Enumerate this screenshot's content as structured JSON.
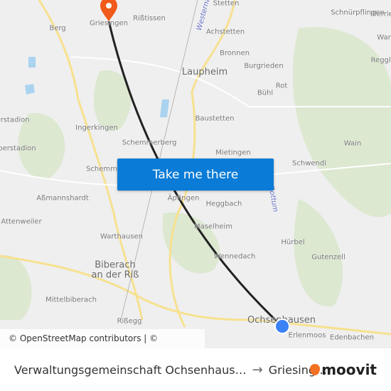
{
  "map": {
    "labels": {
      "griesingen": "Griesingen",
      "risstissen": "Rißtissen",
      "stetten": "Stetten",
      "westernach": "Westernach",
      "schnurpflingen": "Schnürpflingen",
      "illerrieden": "Illerrie",
      "berg": "Berg",
      "achstetten": "Achstetten",
      "wain_top": "War",
      "bronnen": "Bronnen",
      "regglisweiler": "Reggli",
      "laupheim": "Laupheim",
      "burgrieden": "Burgrieden",
      "rot": "Rot",
      "buhl": "Bühl",
      "baustetten": "Baustetten",
      "erstadion": "erstadion",
      "ingerkingen": "Ingerkingen",
      "berstadion": "berstadion",
      "schemmerberg": "Schemmerberg",
      "mietingen": "Mietingen",
      "wain": "Wain",
      "schwendi": "Schwendi",
      "schemmerhofen": "Schemm",
      "assmannshardt": "Aßmannshardt",
      "aepfingen": "Äpfingen",
      "heggbach": "Heggbach",
      "rottum": "Rottum",
      "attenweiler": "Attenweiler",
      "maselheim": "Maselheim",
      "hurbel": "Hürbel",
      "warthausen": "Warthausen",
      "gutenzell": "Gutenzell",
      "wennedach": "Wennedach",
      "biberach": "Biberach an der Riß",
      "mittelbiberach": "Mittelbiberach",
      "rissegg": "Rißegg",
      "ochsenhausen": "Ochsenhausen",
      "erlenmoos": "Erlenmoos",
      "edenbachen": "Edenbachen"
    },
    "origin_marker_color": "#3b82f6",
    "destination_marker_color": "#f05a1a",
    "route_color": "#222222"
  },
  "cta_label": "Take me there",
  "attribution": "© OpenStreetMap contributors | © OpenMapTiles",
  "footer": {
    "from": "Verwaltungsgemeinschaft Ochsenhaus…",
    "arrow": "→",
    "to": "Griesing…",
    "brand": "moovit"
  }
}
